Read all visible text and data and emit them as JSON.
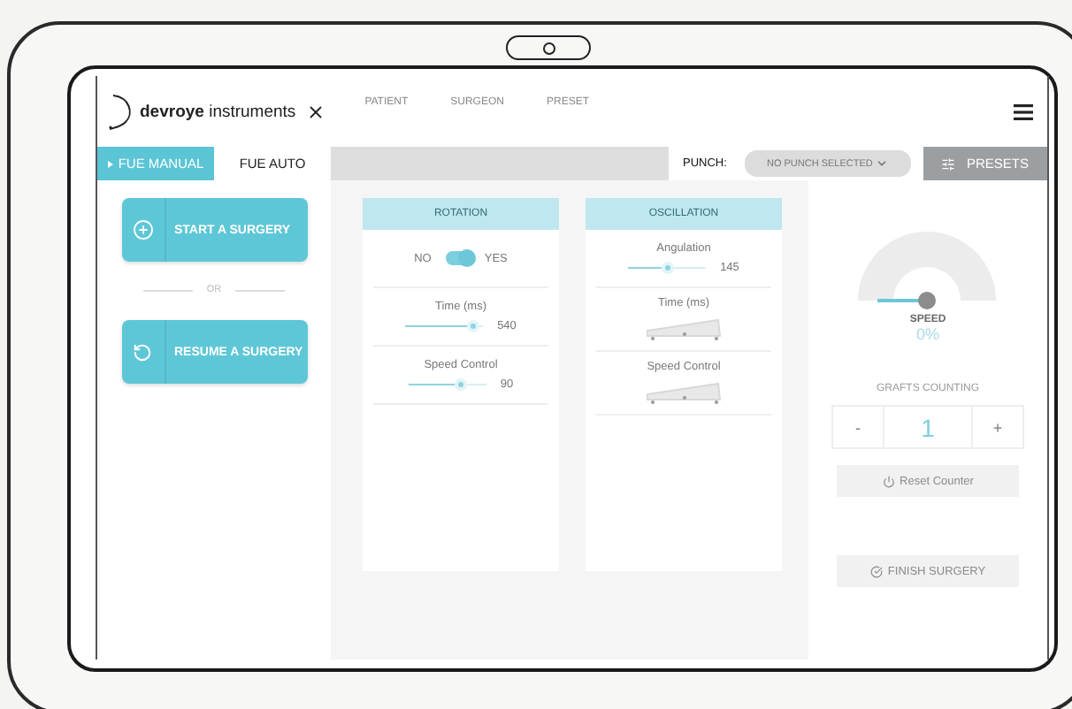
{
  "header": {
    "logo_text": "**devroye** instruments",
    "nav": [
      {
        "label": "PATIENT"
      },
      {
        "label": "SURGEON"
      },
      {
        "label": "PRESET"
      }
    ]
  },
  "tabs": [
    {
      "label": "FUE MANUAL",
      "selected": true
    },
    {
      "label": "FUE AUTO",
      "selected": false
    }
  ],
  "punch": {
    "label": "PUNCH:",
    "placeholder": "NO PUNCH SELECTED"
  },
  "presets_button": "PRESETS",
  "actions": {
    "start": "START A SURGERY",
    "separator": "OR",
    "resume": "RESUME A SURGERY"
  },
  "panels": [
    {
      "title": "ROTATION",
      "rows": [
        {
          "kind": "toggle",
          "off_label": "NO",
          "on_label": "YES",
          "on": true
        },
        {
          "kind": "slider",
          "label": "Time (ms)",
          "level": 0.87,
          "reading": "540"
        },
        {
          "kind": "slider",
          "label": "Speed Control",
          "level": 0.68,
          "reading": "90"
        }
      ]
    },
    {
      "title": "OSCILLATION",
      "rows": [
        {
          "kind": "slider",
          "label": "Angulation",
          "level": 0.5,
          "reading": "145"
        },
        {
          "kind": "pedal",
          "label": "Time (ms)"
        },
        {
          "kind": "pedal",
          "label": "Speed Control"
        }
      ]
    }
  ],
  "speed": {
    "label": "SPEED",
    "reading": "0%"
  },
  "grafts": {
    "title": "GRAFTS COUNTING",
    "minus": "-",
    "value": "1",
    "plus": "+"
  },
  "reset_button": {
    "label": "Reset Counter",
    "disabled": true
  },
  "finish_button": {
    "label": "FINISH SURGERY",
    "disabled": true
  }
}
